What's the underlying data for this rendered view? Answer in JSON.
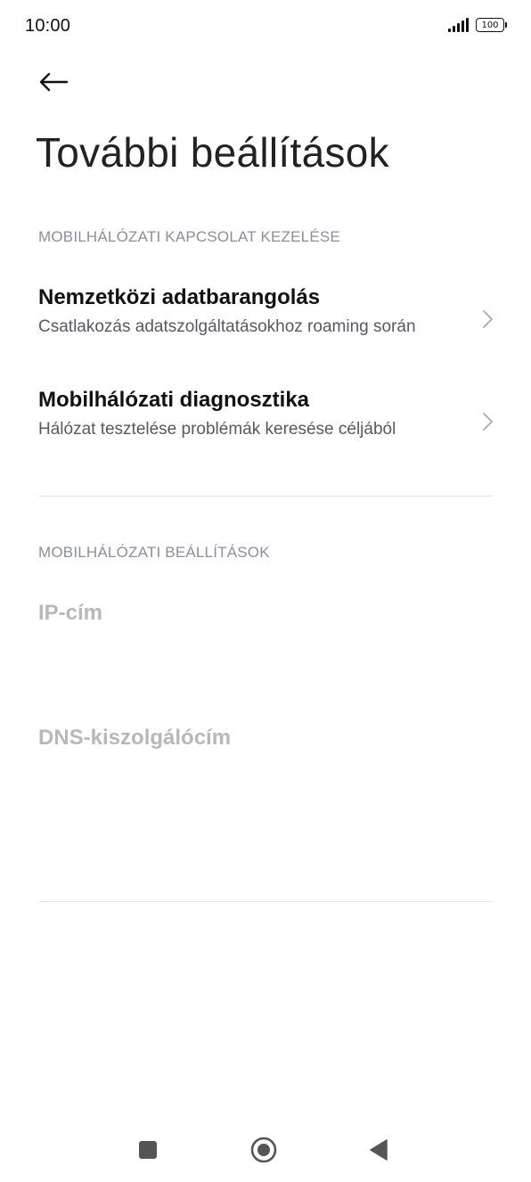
{
  "status_bar": {
    "time": "10:00",
    "battery": "100"
  },
  "header": {
    "title": "További beállítások"
  },
  "sections": [
    {
      "header": "MOBILHÁLÓZATI KAPCSOLAT KEZELÉSE",
      "items": [
        {
          "title": "Nemzetközi adatbarangolás",
          "subtitle": "Csatlakozás adatszolgáltatásokhoz roaming során"
        },
        {
          "title": "Mobilhálózati diagnosztika",
          "subtitle": "Hálózat tesztelése problémák keresése céljából"
        }
      ]
    },
    {
      "header": "MOBILHÁLÓZATI BEÁLLÍTÁSOK",
      "items": [
        {
          "title": "IP-cím"
        },
        {
          "title": "DNS-kiszolgálócím"
        }
      ]
    }
  ],
  "colors": {
    "section_header": "#8a8f9e",
    "disabled_text": "#b8b8bc",
    "subtitle": "#555a62"
  },
  "icons": {
    "back": "arrow-left-icon",
    "chevron": "chevron-right-icon",
    "nav_recents": "square-icon",
    "nav_home": "circle-icon",
    "nav_back": "triangle-back-icon"
  }
}
